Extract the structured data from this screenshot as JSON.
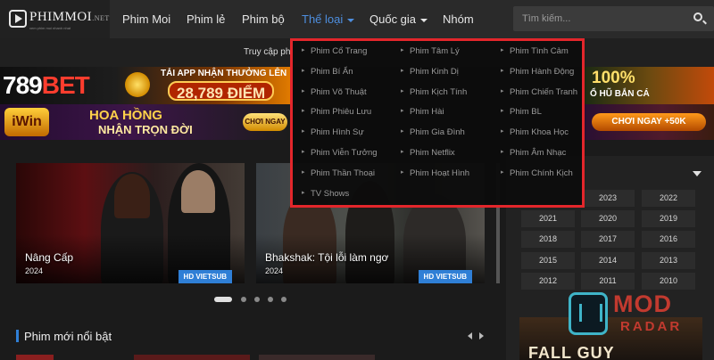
{
  "header": {
    "logo": {
      "name": "PHIMMOI",
      "suffix": ".NET",
      "tagline": "xem phim moi nhanh nhat"
    },
    "nav": [
      {
        "label": "Phim Moi"
      },
      {
        "label": "Phim lẻ"
      },
      {
        "label": "Phim bộ"
      },
      {
        "label": "Thể loại",
        "active": true
      },
      {
        "label": "Quốc gia"
      },
      {
        "label": "Nhóm"
      }
    ],
    "search": {
      "placeholder": "Tìm kiếm..."
    }
  },
  "notice": {
    "text": "Truy cập phi"
  },
  "genre_menu": {
    "columns": [
      [
        "Phim Cổ Trang",
        "Phim Bí Ẩn",
        "Phim Võ Thuật",
        "Phim Phiêu Lưu",
        "Phim Hình Sự",
        "Phim Viễn Tưởng",
        "Phim Thần Thoại",
        "TV Shows"
      ],
      [
        "Phim Tâm Lý",
        "Phim Kinh Dị",
        "Phim Kịch Tính",
        "Phim Hài",
        "Phim Gia Đình",
        "Phim Netflix",
        "Phim Hoạt Hình"
      ],
      [
        "Phim Tình Cảm",
        "Phim Hành Động",
        "Phim Chiến Tranh",
        "Phim BL",
        "Phim Khoa Học",
        "Phim Âm Nhạc",
        "Phim Chính Kịch"
      ]
    ]
  },
  "banners": {
    "b789": {
      "brand_left": "789",
      "brand_right": "BET",
      "line1": "TẢI APP NHẬN THƯỞNG LÊN",
      "line2": "28,789 ĐIỂM"
    },
    "right1": {
      "pct": "100%",
      "sub": "Ổ HŨ BẮN CÁ"
    },
    "iwin": {
      "logo": "iWin",
      "line1": "HOA HỒNG",
      "line2": "NHẬN TRỌN ĐỜI",
      "button": "CHƠI NGAY"
    },
    "right2": {
      "pill": "CHƠI NGAY +50K"
    }
  },
  "slides": [
    {
      "title": "Nâng Cấp",
      "year": "2024",
      "badge": "HD VIETSUB"
    },
    {
      "title": "Bhakshak: Tội lỗi làm ngơ",
      "year": "2024",
      "badge": "HD VIETSUB"
    }
  ],
  "slider_dots": {
    "count": 5,
    "active": 0
  },
  "sidebar": {
    "years": [
      "2023",
      "2022",
      "2021",
      "2020",
      "2019",
      "2018",
      "2017",
      "2016",
      "2015",
      "2014",
      "2013",
      "2012",
      "2011",
      "2010"
    ]
  },
  "poster": {
    "title": "FALL GUY"
  },
  "section": {
    "title": "Phim mới nổi bật"
  },
  "watermark": {
    "line1": "MOD",
    "line2": "RADAR"
  },
  "colors": {
    "accent": "#2f7fd6",
    "highlight_border": "#e3262b",
    "nav_active": "#4e8fe0"
  }
}
